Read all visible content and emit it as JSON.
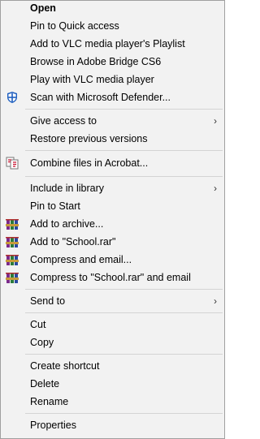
{
  "items": {
    "open": "Open",
    "pin_quick": "Pin to Quick access",
    "vlc_playlist": "Add to VLC media player's Playlist",
    "bridge": "Browse in Adobe Bridge CS6",
    "vlc_play": "Play with VLC media player",
    "defender": "Scan with Microsoft Defender...",
    "give_access": "Give access to",
    "restore": "Restore previous versions",
    "acrobat": "Combine files in Acrobat...",
    "include_library": "Include in library",
    "pin_start": "Pin to Start",
    "add_archive": "Add to archive...",
    "add_rar": "Add to \"School.rar\"",
    "compress_email": "Compress and email...",
    "compress_rar_email": "Compress to \"School.rar\" and email",
    "send_to": "Send to",
    "cut": "Cut",
    "copy": "Copy",
    "create_shortcut": "Create shortcut",
    "delete": "Delete",
    "rename": "Rename",
    "properties": "Properties"
  },
  "submenu_arrow": "›",
  "icons": {
    "defender": "shield-icon",
    "acrobat": "acrobat-combine-icon",
    "winrar": "winrar-books-icon"
  },
  "colors": {
    "menu_bg": "#f2f2f2",
    "border": "#a0a0a0",
    "separator": "#d4d4d4",
    "shield_blue": "#1f5fbf",
    "acrobat_red": "#c8102e"
  }
}
